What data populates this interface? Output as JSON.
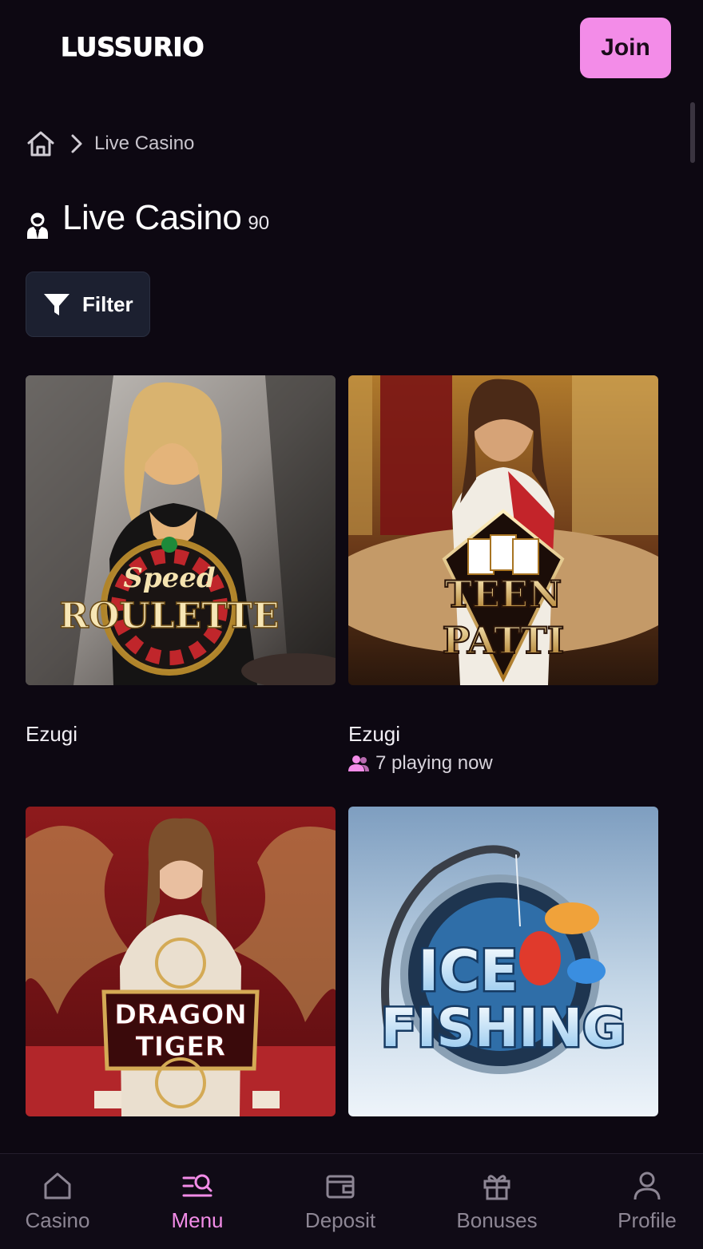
{
  "header": {
    "logo": "LUSSURIO",
    "join_label": "Join"
  },
  "breadcrumb": {
    "home_icon": "home-icon",
    "current": "Live Casino"
  },
  "page": {
    "title": "Live Casino",
    "count": "90",
    "filter_label": "Filter"
  },
  "games": [
    {
      "art_text_top": "Speed",
      "art_text_main": "ROULETTE",
      "provider": "Ezugi",
      "playing": ""
    },
    {
      "art_text_top": "TEEN",
      "art_text_main": "PATTI",
      "provider": "Ezugi",
      "playing": "7 playing now"
    },
    {
      "art_text_top": "DRAGON",
      "art_text_main": "TIGER",
      "provider": "",
      "playing": ""
    },
    {
      "art_text_top": "ICE",
      "art_text_main": "FISHING",
      "provider": "",
      "playing": ""
    }
  ],
  "nav": {
    "items": [
      {
        "label": "Casino",
        "icon": "home-icon"
      },
      {
        "label": "Menu",
        "icon": "menu-search-icon"
      },
      {
        "label": "Deposit",
        "icon": "wallet-icon"
      },
      {
        "label": "Bonuses",
        "icon": "gift-icon"
      },
      {
        "label": "Profile",
        "icon": "user-icon"
      }
    ],
    "active_index": 1
  },
  "colors": {
    "background": "#0d0812",
    "accent": "#f38ce8",
    "filter_bg": "#1c2030",
    "nav_inactive": "#8d8694"
  }
}
